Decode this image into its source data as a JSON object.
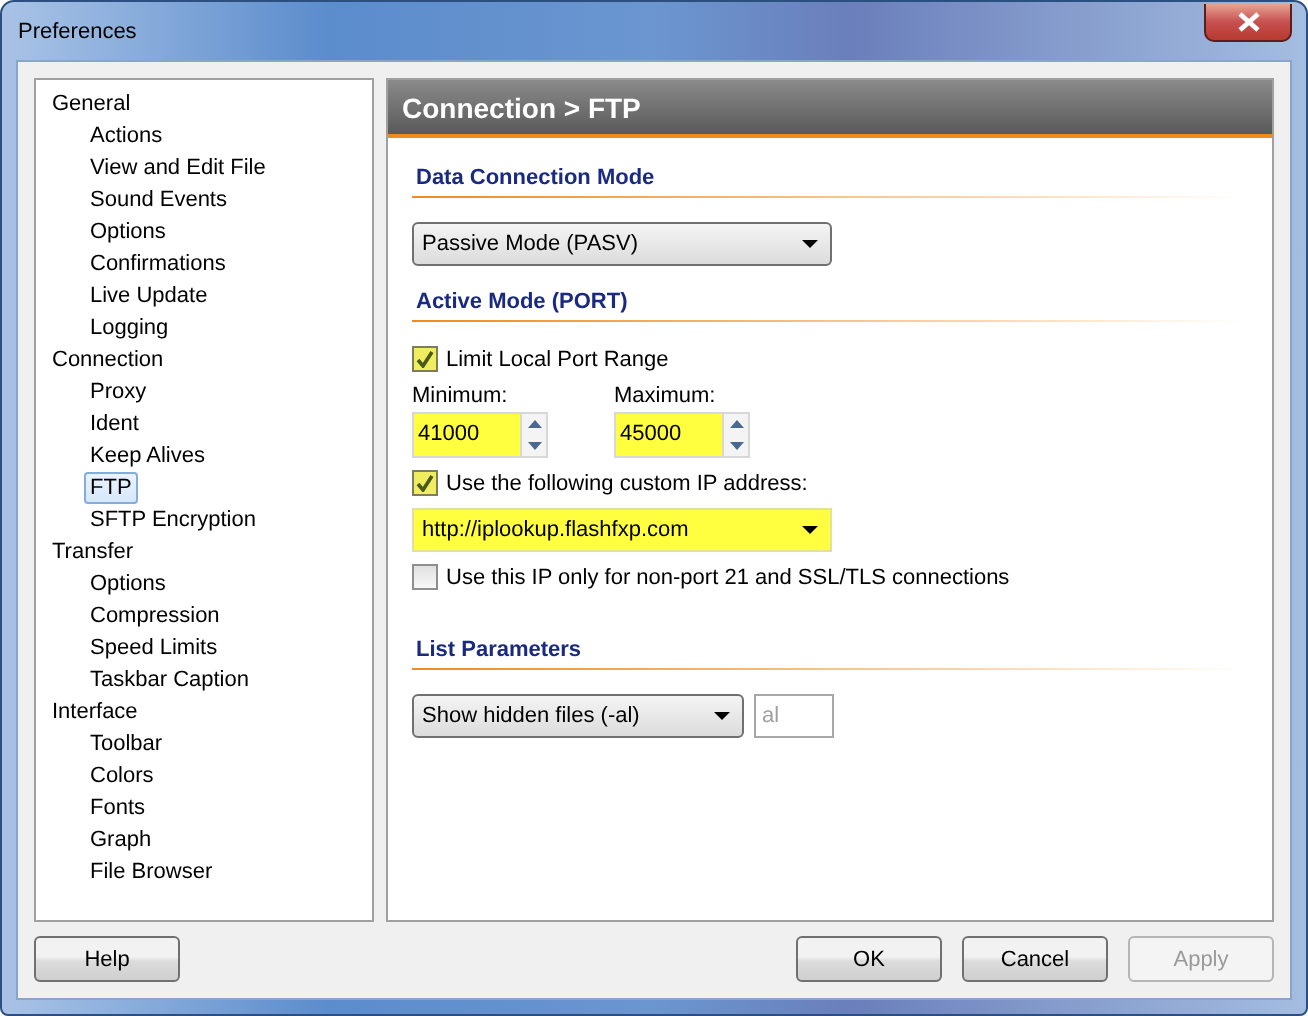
{
  "window": {
    "title": "Preferences"
  },
  "tree": [
    {
      "label": "General",
      "selected": false,
      "children": [
        {
          "label": "Actions",
          "selected": false
        },
        {
          "label": "View and Edit File",
          "selected": false
        },
        {
          "label": "Sound Events",
          "selected": false
        },
        {
          "label": "Options",
          "selected": false
        },
        {
          "label": "Confirmations",
          "selected": false
        },
        {
          "label": "Live Update",
          "selected": false
        },
        {
          "label": "Logging",
          "selected": false
        }
      ]
    },
    {
      "label": "Connection",
      "selected": false,
      "children": [
        {
          "label": "Proxy",
          "selected": false
        },
        {
          "label": "Ident",
          "selected": false
        },
        {
          "label": "Keep Alives",
          "selected": false
        },
        {
          "label": "FTP",
          "selected": true
        },
        {
          "label": "SFTP Encryption",
          "selected": false
        }
      ]
    },
    {
      "label": "Transfer",
      "selected": false,
      "children": [
        {
          "label": "Options",
          "selected": false
        },
        {
          "label": "Compression",
          "selected": false
        },
        {
          "label": "Speed Limits",
          "selected": false
        },
        {
          "label": "Taskbar Caption",
          "selected": false
        }
      ]
    },
    {
      "label": "Interface",
      "selected": false,
      "children": [
        {
          "label": "Toolbar",
          "selected": false
        },
        {
          "label": "Colors",
          "selected": false
        },
        {
          "label": "Fonts",
          "selected": false
        },
        {
          "label": "Graph",
          "selected": false
        },
        {
          "label": "File Browser",
          "selected": false
        }
      ]
    }
  ],
  "panel": {
    "title": "Connection > FTP",
    "sections": [
      {
        "heading": "Data Connection Mode",
        "controls": [
          {
            "kind": "dropdown",
            "value": "Passive Mode (PASV)",
            "highlighted": false
          }
        ]
      },
      {
        "heading": "Active Mode (PORT)",
        "controls": [
          {
            "kind": "checkbox",
            "label": "Limit Local Port Range",
            "checked": true
          },
          {
            "kind": "spinners",
            "fields": [
              {
                "label": "Minimum:",
                "value": "41000",
                "highlighted": true
              },
              {
                "label": "Maximum:",
                "value": "45000",
                "highlighted": true
              }
            ]
          },
          {
            "kind": "checkbox",
            "label": "Use the following custom IP address:",
            "checked": true
          },
          {
            "kind": "dropdown",
            "value": "http://iplookup.flashfxp.com",
            "highlighted": true
          },
          {
            "kind": "checkbox",
            "label": "Use this IP only for non-port 21 and SSL/TLS connections",
            "checked": false
          }
        ]
      },
      {
        "heading": "List Parameters",
        "controls": [
          {
            "kind": "dropdown_field",
            "value": "Show hidden files (-al)",
            "highlighted": false,
            "field": {
              "value": "al",
              "disabled": true
            }
          }
        ]
      }
    ]
  },
  "buttons": [
    {
      "label": "Help",
      "disabled": false
    },
    {
      "label": "OK",
      "disabled": false
    },
    {
      "label": "Cancel",
      "disabled": false
    },
    {
      "label": "Apply",
      "disabled": true
    }
  ]
}
